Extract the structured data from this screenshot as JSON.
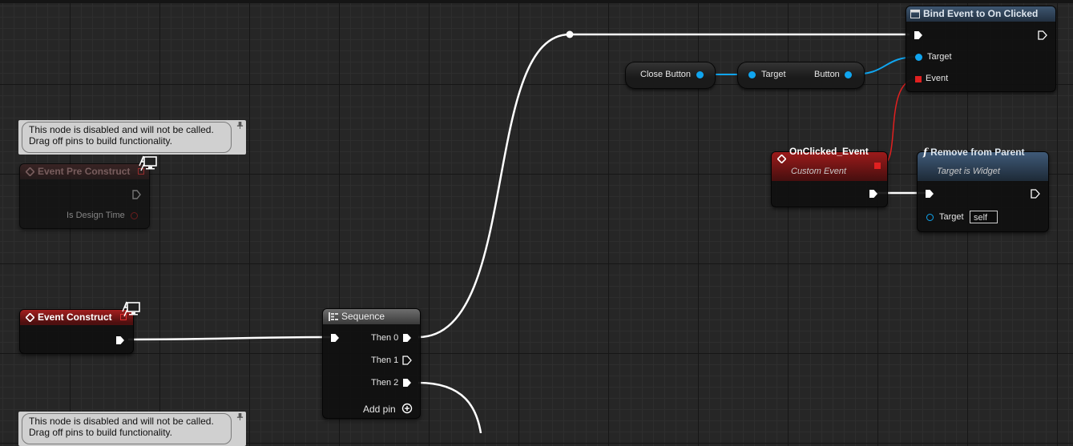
{
  "comments": {
    "disabled_line1": "This node is disabled and will not be called.",
    "disabled_line2": "Drag off pins to build functionality."
  },
  "nodes": {
    "event_pre_construct": {
      "title": "Event Pre Construct",
      "pin_design_time": "Is Design Time"
    },
    "event_construct": {
      "title": "Event Construct"
    },
    "sequence": {
      "title": "Sequence",
      "then0": "Then 0",
      "then1": "Then 1",
      "then2": "Then 2",
      "add_pin": "Add pin"
    },
    "bind_event": {
      "title": "Bind Event to On Clicked",
      "pin_target": "Target",
      "pin_event": "Event"
    },
    "close_button": {
      "label": "Close Button"
    },
    "get_button": {
      "pin_target": "Target",
      "pin_button": "Button"
    },
    "onclicked_event": {
      "title": "OnClicked_Event",
      "subtitle": "Custom Event"
    },
    "remove_from_parent": {
      "title": "Remove from Parent",
      "subtitle": "Target is Widget",
      "pin_target": "Target",
      "target_value": "self"
    }
  },
  "colors": {
    "event_header": "#a51e1e",
    "function_header": "#3e5670",
    "object_pin": "#10a5ef",
    "delegate_pin": "#e02020",
    "exec_wire": "#ffffff"
  }
}
